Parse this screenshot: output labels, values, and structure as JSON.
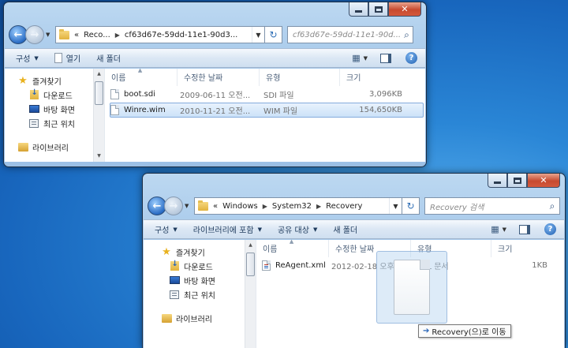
{
  "window1": {
    "address": {
      "crumb_prefix": "«",
      "crumbs": [
        "Reco...",
        "cf63d67e-59dd-11e1-90d3..."
      ]
    },
    "search": {
      "placeholder": "cf63d67e-59dd-11e1-90d..."
    },
    "commands": {
      "organize": "구성",
      "open": "열기",
      "new_folder": "새 폴더"
    },
    "nav": {
      "favorites": "즐겨찾기",
      "downloads": "다운로드",
      "desktop": "바탕 화면",
      "recent": "최근 위치",
      "libraries": "라이브러리"
    },
    "columns": {
      "name": "이름",
      "date": "수정한 날짜",
      "type": "유형",
      "size": "크기"
    },
    "files": [
      {
        "name": "boot.sdi",
        "date": "2009-06-11 오전...",
        "type": "SDI 파일",
        "size": "3,096KB",
        "selected": false
      },
      {
        "name": "Winre.wim",
        "date": "2010-11-21 오전...",
        "type": "WIM 파일",
        "size": "154,650KB",
        "selected": true
      }
    ]
  },
  "window2": {
    "address": {
      "crumb_prefix": "«",
      "crumbs": [
        "Windows",
        "System32",
        "Recovery"
      ]
    },
    "search": {
      "placeholder": "Recovery 검색"
    },
    "commands": {
      "organize": "구성",
      "include_library": "라이브러리에 포함",
      "share": "공유 대상",
      "new_folder": "새 폴더"
    },
    "nav": {
      "favorites": "즐겨찾기",
      "downloads": "다운로드",
      "desktop": "바탕 화면",
      "recent": "최근 위치",
      "libraries": "라이브러리"
    },
    "columns": {
      "name": "이름",
      "date": "수정한 날짜",
      "type": "유형",
      "size": "크기"
    },
    "files": [
      {
        "name": "ReAgent.xml",
        "date": "2012-02-18 오후...",
        "type": "XML 문서",
        "size": "1KB"
      }
    ]
  },
  "drag": {
    "tooltip": "Recovery(으)로 이동"
  },
  "colors": {
    "selection": "#cce2f8",
    "titlebar": "#a6c8ea",
    "close": "#c74a2f",
    "desktop": "#1866bd"
  }
}
